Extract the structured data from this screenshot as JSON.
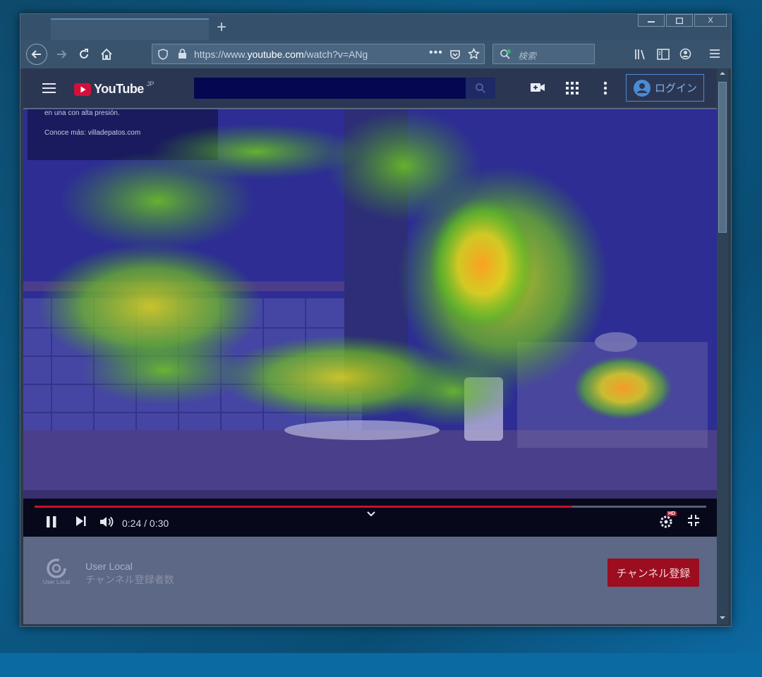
{
  "browser": {
    "url_prefix": "https://www.",
    "url_domain": "youtube.com",
    "url_suffix": "/watch?v=ANg",
    "search_placeholder": "検索",
    "new_tab_symbol": "+",
    "window_controls": {
      "minimize": "—",
      "maximize": "□",
      "close": "X"
    }
  },
  "youtube": {
    "logo_text": "YouTube",
    "logo_region": "JP",
    "login_label": "ログイン"
  },
  "video": {
    "overlay_lines": [
      "en una con alta presión.",
      "Conoce más: villadepatos.com"
    ],
    "time_display": "0:24 / 0:30",
    "progress_fraction": 0.8,
    "hd_badge": "HD"
  },
  "channel": {
    "name": "User Local",
    "subscribers_label": "チャンネル登録者数",
    "logo_caption": "User Local",
    "subscribe_label": "チャンネル登録"
  },
  "colors": {
    "accent_red": "#c8102e",
    "subscribe_bg": "#9c0d20",
    "login_blue": "#4a8bd6"
  }
}
